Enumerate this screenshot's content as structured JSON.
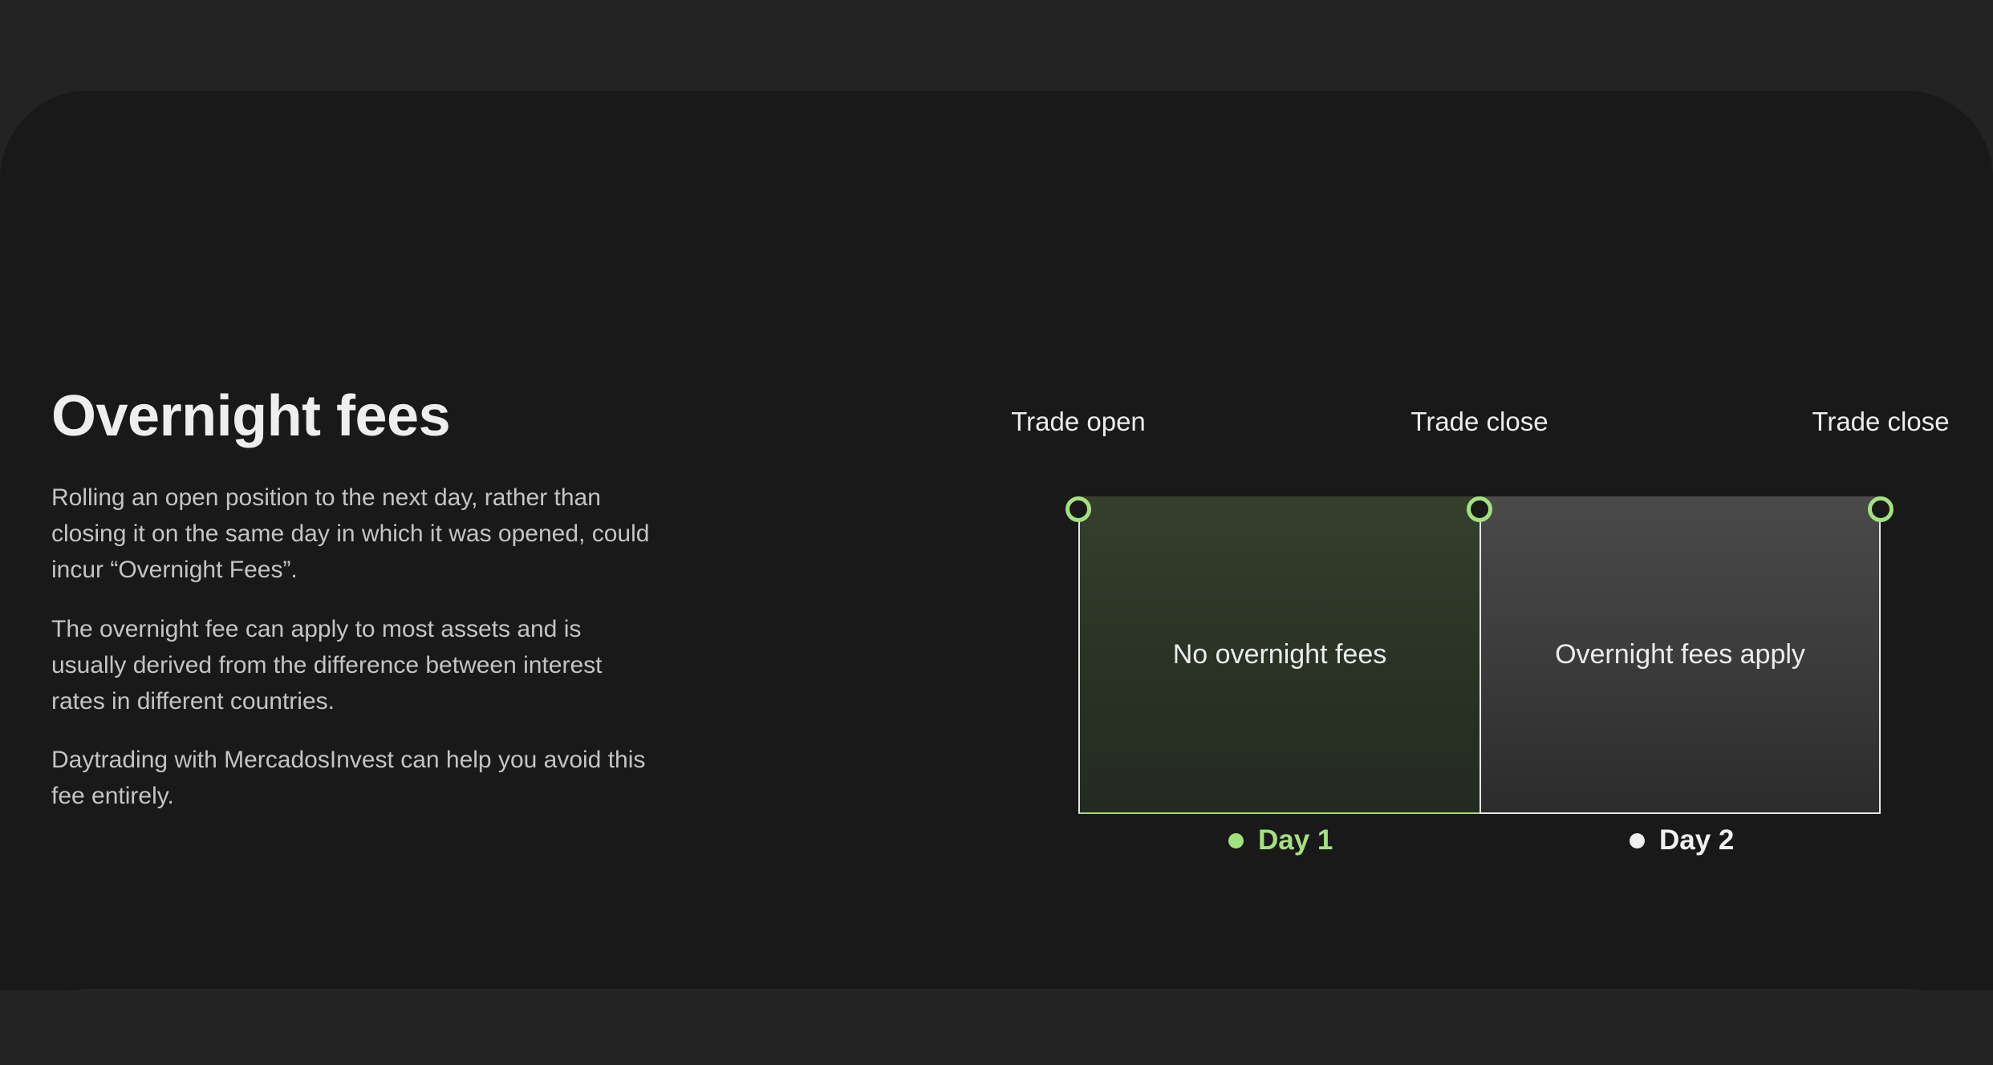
{
  "section": {
    "title": "Overnight fees",
    "paragraphs": [
      "Rolling an open position to the next day, rather than closing it on the same day in which it was opened, could incur “Overnight Fees”.",
      "The overnight fee can apply to most assets and is usually derived from the difference between interest rates in different countries.",
      "Daytrading with MercadosInvest can help you avoid this fee entirely."
    ]
  },
  "diagram": {
    "markers": [
      {
        "label": "Trade open"
      },
      {
        "label": "Trade close"
      },
      {
        "label": "Trade close"
      }
    ],
    "periods": [
      {
        "label": "No overnight fees",
        "day": "Day 1"
      },
      {
        "label": "Overnight fees apply",
        "day": "Day 2"
      }
    ]
  },
  "colors": {
    "accent": "#a3e07f",
    "background": "#191919",
    "outer_background": "#232323",
    "text": "#eeeeee"
  }
}
